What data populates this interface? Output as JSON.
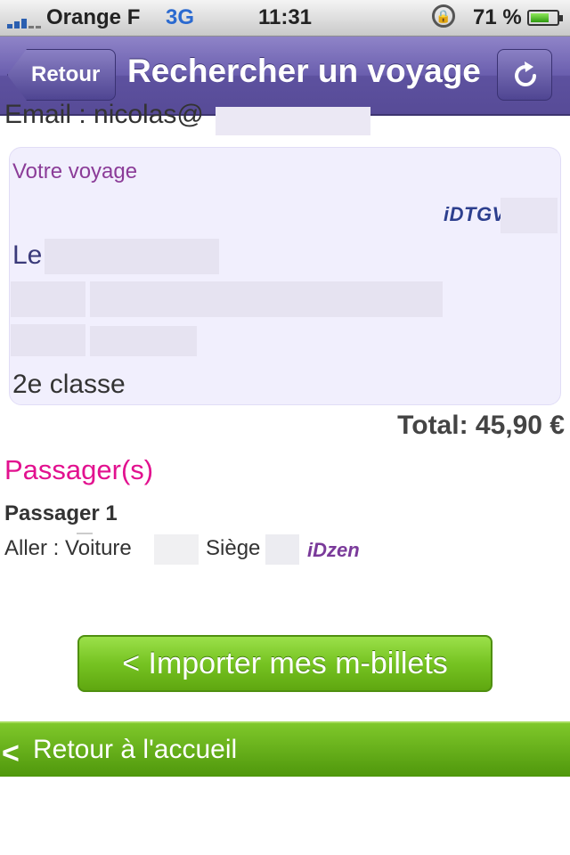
{
  "status_bar": {
    "carrier": "Orange F",
    "network": "3G",
    "time": "11:31",
    "battery": "71 %",
    "icons": [
      "signal-icon",
      "rotation-lock-icon",
      "battery-icon"
    ]
  },
  "navbar": {
    "back_label": "Retour",
    "title": "Rechercher un voyage",
    "refresh_icon": "refresh-icon",
    "color": "#6a5eae"
  },
  "email": {
    "label": "Email : nicolas@"
  },
  "trip": {
    "heading": "Votre voyage",
    "brand": "iDTGV",
    "date_prefix": "Le",
    "class": "2e classe"
  },
  "total": "Total: 45,90 €",
  "passengers": {
    "title": "Passager(s)",
    "items": [
      {
        "name": "Passager 1",
        "aller_label": "Aller",
        "voiture_label": "Voiture",
        "siege_label": "Siège",
        "zone": "iDzen"
      }
    ]
  },
  "actions": {
    "import_label": "< Importer mes m-billets",
    "home_label": "Retour à l'accueil",
    "accent": "#76c322"
  }
}
